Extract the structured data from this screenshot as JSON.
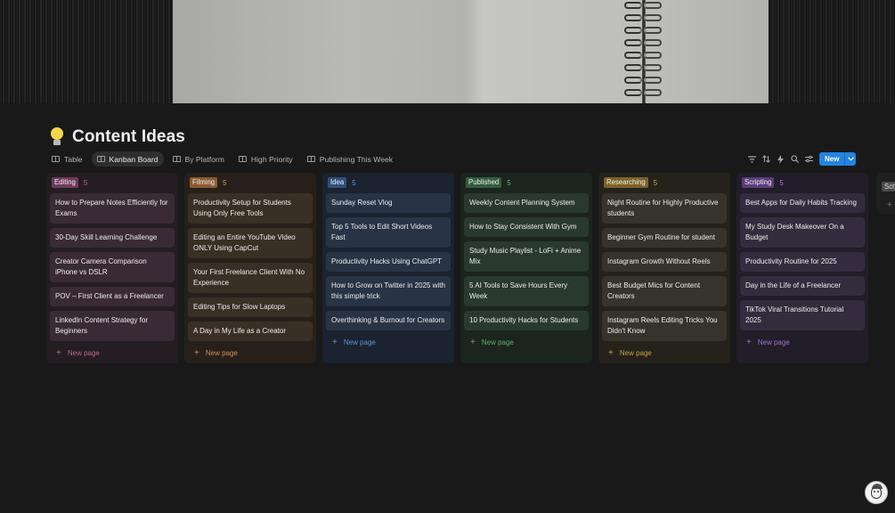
{
  "page": {
    "title": "Content Ideas",
    "icon": "lightbulb-icon"
  },
  "views": [
    {
      "label": "Table",
      "icon": "table-icon"
    },
    {
      "label": "Kanban Board",
      "icon": "board-icon",
      "active": true
    },
    {
      "label": "By Platform",
      "icon": "table-icon"
    },
    {
      "label": "High Priority",
      "icon": "table-icon"
    },
    {
      "label": "Publishing This Week",
      "icon": "table-icon"
    }
  ],
  "toolbar": {
    "new_label": "New",
    "icons": [
      "filter-icon",
      "sort-icon",
      "lightning-icon",
      "search-icon",
      "settings-icon"
    ]
  },
  "new_page_label": "New page",
  "columns": [
    {
      "name": "Editing",
      "count": "5",
      "theme": "editing",
      "cards": [
        "How to Prepare Notes Efficiently for Exams",
        "30-Day Skill Learning Challenge",
        "Creator Camera Comparison iPhone vs DSLR",
        "POV – First Client as a Freelancer",
        "LinkedIn Content Strategy for Beginners"
      ]
    },
    {
      "name": "Filming",
      "count": "5",
      "theme": "filming",
      "cards": [
        "Productivity Setup for Students Using Only Free Tools",
        "Editing an Entire YouTube Video ONLY Using CapCut",
        "Your First Freelance Client With No Experience",
        "Editing Tips for Slow Laptops",
        "A Day in My Life as a Creator"
      ]
    },
    {
      "name": "Idea",
      "count": "5",
      "theme": "idea",
      "cards": [
        "Sunday Reset Vlog",
        "Top 5 Tools to Edit Short Videos Fast",
        "Productivity Hacks Using ChatGPT",
        "How to Grow on Twitter in 2025 with this simple trick",
        "Overthinking & Burnout for Creators"
      ]
    },
    {
      "name": "Published",
      "count": "5",
      "theme": "published",
      "cards": [
        "Weekly Content Planning System",
        "How to Stay Consistent With Gym",
        "Study Music Playlist - LoFi + Anime Mix",
        "5 AI Tools to Save Hours Every Week",
        "10 Productivity Hacks for Students"
      ]
    },
    {
      "name": "Researching",
      "count": "5",
      "theme": "researching",
      "cards": [
        "Night Routine for Highly Productive students",
        "Beginner Gym Routine for student",
        "Instagram Growth Without Reels",
        "Best Budget Mics for Content Creators",
        "Instagram Reels Editing Tricks You Didn't Know"
      ]
    },
    {
      "name": "Scripting",
      "count": "5",
      "theme": "scripting",
      "cards": [
        "Best Apps for Daily Habits Tracking",
        "My Study Desk Makeover On a Budget",
        "Productivity Routine for 2025",
        "Day in the Life of a Freelancer",
        "TikTok Viral Transitions Tutorial 2025"
      ]
    }
  ],
  "partial_column": {
    "name": "Sch"
  }
}
